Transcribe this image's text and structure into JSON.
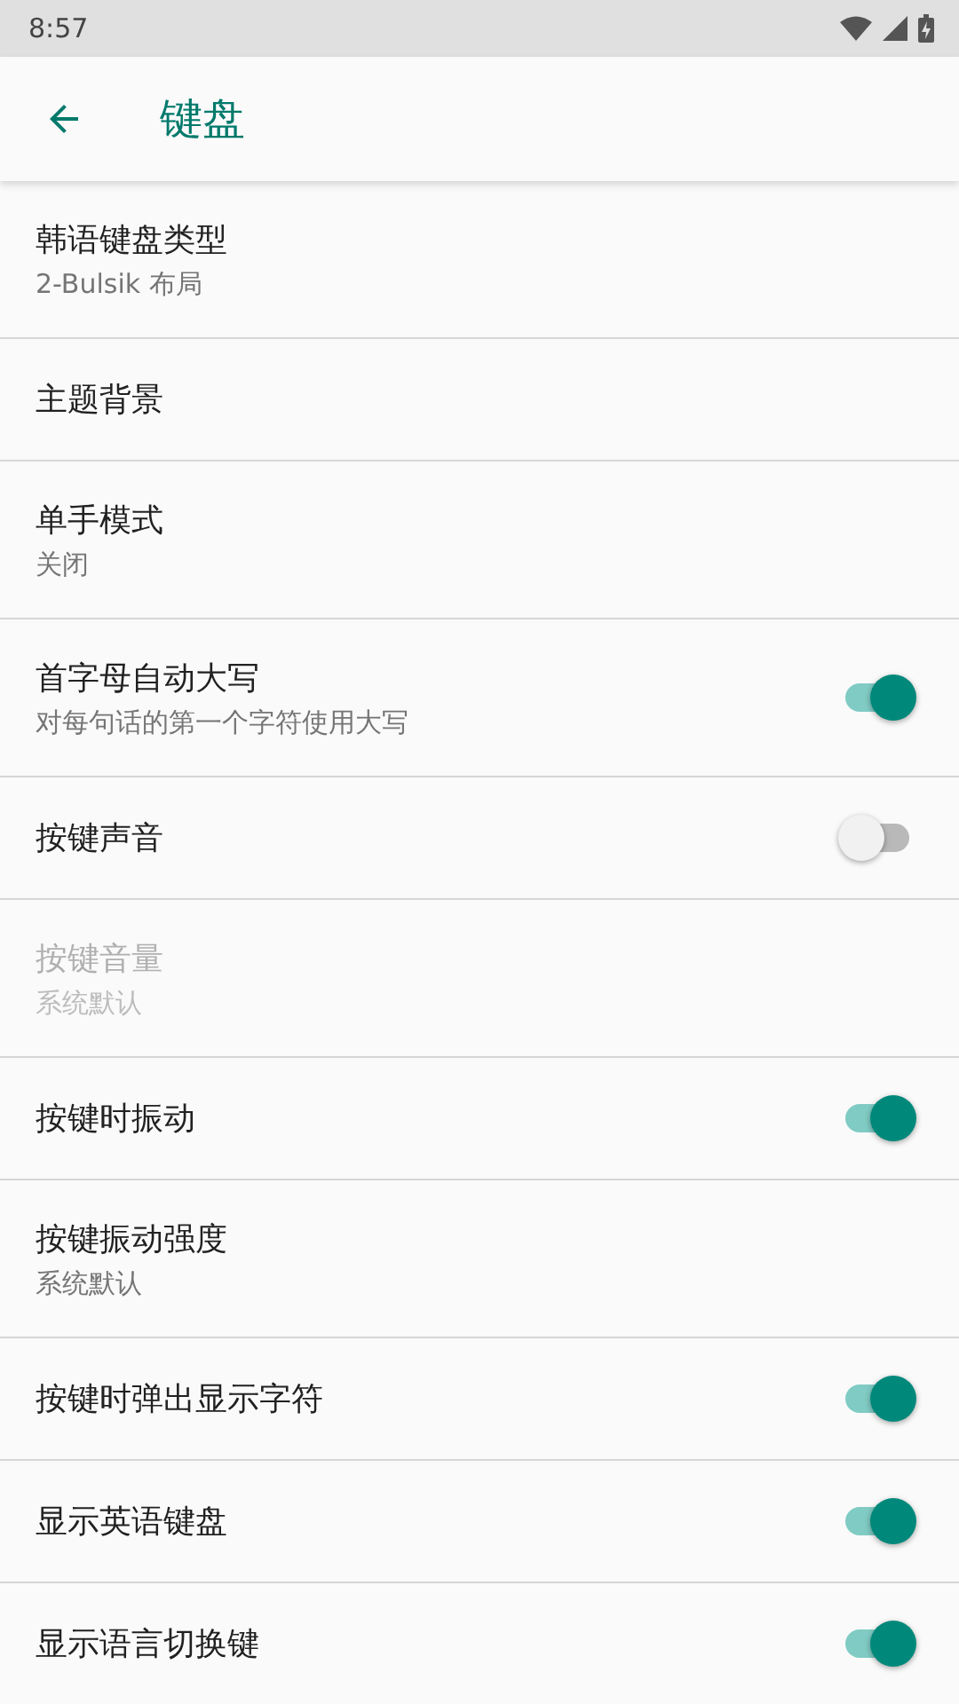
{
  "status_bar": {
    "time": "8:57"
  },
  "app_bar": {
    "title": "键盘"
  },
  "settings": [
    {
      "kind": "plain",
      "title": "韩语键盘类型",
      "summary": "2-Bulsik 布局",
      "disabled": false
    },
    {
      "kind": "plain",
      "title": "主题背景",
      "disabled": false
    },
    {
      "kind": "plain",
      "title": "单手模式",
      "summary": "关闭",
      "disabled": false
    },
    {
      "kind": "switch",
      "title": "首字母自动大写",
      "summary": "对每句话的第一个字符使用大写",
      "disabled": false,
      "on": true
    },
    {
      "kind": "switch",
      "title": "按键声音",
      "disabled": false,
      "on": false
    },
    {
      "kind": "plain",
      "title": "按键音量",
      "summary": "系统默认",
      "disabled": true
    },
    {
      "kind": "switch",
      "title": "按键时振动",
      "disabled": false,
      "on": true
    },
    {
      "kind": "plain",
      "title": "按键振动强度",
      "summary": "系统默认",
      "disabled": false
    },
    {
      "kind": "switch",
      "title": "按键时弹出显示字符",
      "disabled": false,
      "on": true
    },
    {
      "kind": "switch",
      "title": "显示英语键盘",
      "disabled": false,
      "on": true
    },
    {
      "kind": "switch",
      "title": "显示语言切换键",
      "disabled": false,
      "on": true
    }
  ]
}
